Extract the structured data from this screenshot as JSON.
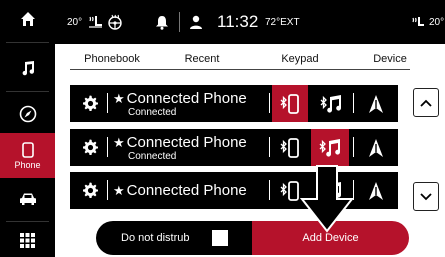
{
  "status_bar": {
    "seat_temp": "20°",
    "time": "11:32",
    "ext_temp": "72°EXT",
    "passenger_temp": "20°"
  },
  "sidebar": {
    "items": [
      {
        "id": "home",
        "icon": "home-icon",
        "label": ""
      },
      {
        "id": "media",
        "icon": "music-note-icon",
        "label": ""
      },
      {
        "id": "nav",
        "icon": "compass-icon",
        "label": ""
      },
      {
        "id": "phone",
        "icon": "phone-icon",
        "label": "Phone",
        "active": true
      },
      {
        "id": "vehicle",
        "icon": "car-icon",
        "label": ""
      },
      {
        "id": "apps",
        "icon": "grid-icon",
        "label": ""
      }
    ]
  },
  "tabs": [
    "Phonebook",
    "Recent",
    "Keypad",
    "Device"
  ],
  "devices": [
    {
      "name": "Connected Phone",
      "status": "Connected",
      "phone_active": true,
      "audio_active": false
    },
    {
      "name": "Connected Phone",
      "status": "Connected",
      "phone_active": false,
      "audio_active": true
    },
    {
      "name": "Connected Phone",
      "status": "",
      "phone_active": false,
      "audio_active": false
    }
  ],
  "bottom": {
    "do_not_disturb": "Do not distrub",
    "add_device": "Add Device"
  },
  "colors": {
    "accent": "#b5122b",
    "bar": "#000000"
  }
}
